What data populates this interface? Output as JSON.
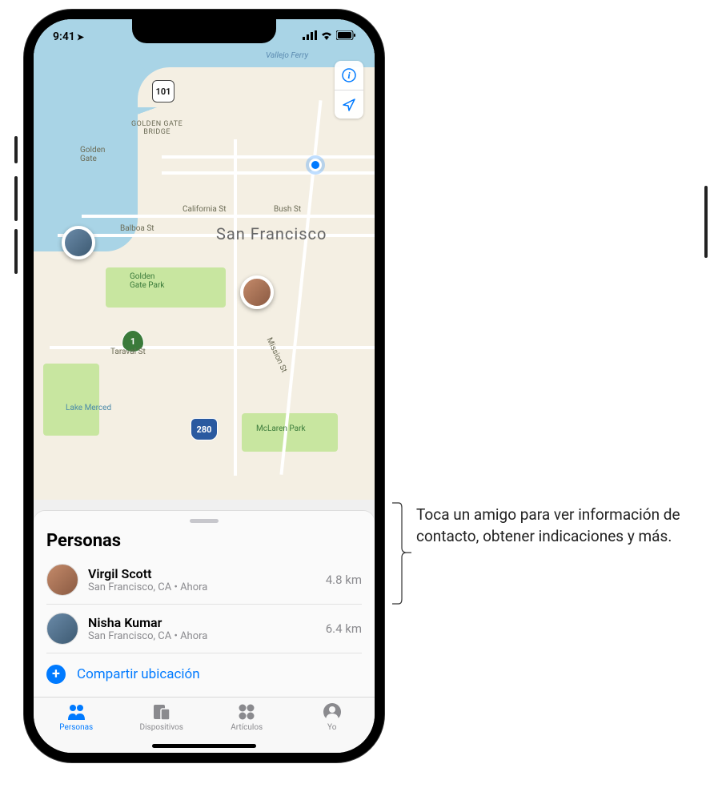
{
  "status": {
    "time": "9:41",
    "location_arrow": "↗"
  },
  "map": {
    "city_label": "San Francisco",
    "labels": {
      "golden_gate": "Golden\nGate",
      "gg_bridge": "GOLDEN GATE\nBRIDGE",
      "gg_park": "Golden\nGate Park",
      "california": "California St",
      "bush": "Bush St",
      "balboa": "Balboa St",
      "taraval": "Taraval St",
      "mission": "Mission St",
      "mclaren": "McLaren Park",
      "lake_merced": "Lake Merced",
      "ferry": "Vallejo Ferry",
      "hwy101": "101",
      "hwy1": "1",
      "hwy280": "280"
    }
  },
  "sheet": {
    "title": "Personas",
    "people": [
      {
        "name": "Virgil Scott",
        "sub": "San Francisco, CA • Ahora",
        "distance": "4.8 km"
      },
      {
        "name": "Nisha Kumar",
        "sub": "San Francisco, CA • Ahora",
        "distance": "6.4 km"
      }
    ],
    "share_label": "Compartir ubicación"
  },
  "tabs": {
    "people": "Personas",
    "devices": "Dispositivos",
    "items": "Artículos",
    "me": "Yo"
  },
  "callout": {
    "text": "Toca un amigo para ver información de contacto, obtener indicaciones y más."
  }
}
